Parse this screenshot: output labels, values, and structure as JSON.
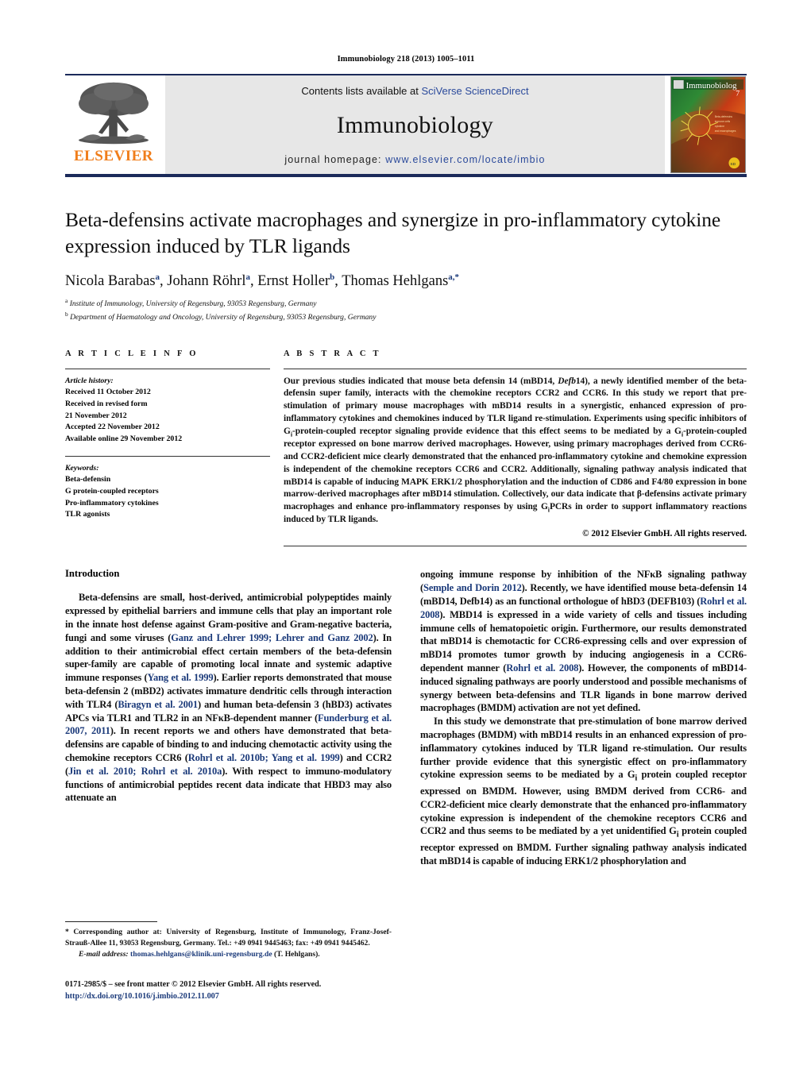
{
  "running_head": "Immunobiology 218 (2013) 1005–1011",
  "masthead": {
    "publisher_name": "ELSEVIER",
    "contents_prefix": "Contents lists available at ",
    "contents_link": "SciVerse ScienceDirect",
    "journal_name": "Immunobiology",
    "homepage_prefix": "journal homepage: ",
    "homepage_url": "www.elsevier.com/locate/imbio",
    "cover_title": "Immunobiology"
  },
  "article": {
    "title": "Beta-defensins activate macrophages and synergize in pro-inflammatory cytokine expression induced by TLR ligands",
    "authors_html": "Nicola Barabas<sup>a</sup>, Johann Röhrl<sup>a</sup>, Ernst Holler<sup>b</sup>, Thomas Hehlgans<sup>a,*</sup>",
    "affiliations": [
      "Institute of Immunology, University of Regensburg, 93053 Regensburg, Germany",
      "Department of Haematology and Oncology, University of Regensburg, 93053 Regensburg, Germany"
    ],
    "affiliation_marks": [
      "a",
      "b"
    ]
  },
  "article_info": {
    "heading": "A R T I C L E   I N F O",
    "history_label": "Article history:",
    "history_lines": [
      "Received 11 October 2012",
      "Received in revised form",
      "21 November 2012",
      "Accepted 22 November 2012",
      "Available online 29 November 2012"
    ],
    "keywords_label": "Keywords:",
    "keywords": [
      "Beta-defensin",
      "G protein-coupled receptors",
      "Pro-inflammatory cytokines",
      "TLR agonists"
    ]
  },
  "abstract": {
    "heading": "A B S T R A C T",
    "text_html": "Our previous studies indicated that mouse beta defensin 14 (mBD14, <i>Defb</i>14), a newly identified member of the beta-defensin super family, interacts with the chemokine receptors CCR2 and CCR6. In this study we report that pre-stimulation of primary mouse macrophages with mBD14 results in a synergistic, enhanced expression of pro-inflammatory cytokines and chemokines induced by TLR ligand re-stimulation. Experiments using specific inhibitors of G<sub>i</sub>-protein-coupled receptor signaling provide evidence that this effect seems to be mediated by a G<sub>i</sub>-protein-coupled receptor expressed on bone marrow derived macrophages. However, using primary macrophages derived from CCR6- and CCR2-deficient mice clearly demonstrated that the enhanced pro-inflammatory cytokine and chemokine expression is independent of the chemokine receptors CCR6 and CCR2. Additionally, signaling pathway analysis indicated that mBD14 is capable of inducing MAPK ERK1/2 phosphorylation and the induction of CD86 and F4/80 expression in bone marrow-derived macrophages after mBD14 stimulation. Collectively, our data indicate that β-defensins activate primary macrophages and enhance pro-inflammatory responses by using G<sub>i</sub>PCRs in order to support inflammatory reactions induced by TLR ligands.",
    "copyright": "© 2012 Elsevier GmbH. All rights reserved."
  },
  "introduction": {
    "heading": "Introduction",
    "left_paragraph_1_html": "Beta-defensins are small, host-derived, antimicrobial polypeptides mainly expressed by epithelial barriers and immune cells that play an important role in the innate host defense against Gram-positive and Gram-negative bacteria, fungi and some viruses (<span class=\"cite\">Ganz and Lehrer 1999; Lehrer and Ganz 2002</span>). In addition to their antimicrobial effect certain members of the beta-defensin super-family are capable of promoting local innate and systemic adaptive immune responses (<span class=\"cite\">Yang et al. 1999</span>). Earlier reports demonstrated that mouse beta-defensin 2 (mBD2) activates immature dendritic cells through interaction with TLR4 (<span class=\"cite\">Biragyn et al. 2001</span>) and human beta-defensin 3 (hBD3) activates APCs via TLR1 and TLR2 in an NFκB-dependent manner (<span class=\"cite\">Funderburg et al. 2007, 2011</span>). In recent reports we and others have demonstrated that beta-defensins are capable of binding to and inducing chemotactic activity using the chemokine receptors CCR6 (<span class=\"cite\">Rohrl et al. 2010b; Yang et al. 1999</span>) and CCR2 (<span class=\"cite\">Jin et al. 2010; Rohrl et al. 2010a</span>). With respect to immuno-modulatory functions of antimicrobial peptides recent data indicate that HBD3 may also attenuate an",
    "right_paragraph_1_html": "ongoing immune response by inhibition of the NFκB signaling pathway (<span class=\"cite\">Semple and Dorin 2012</span>). Recently, we have identified mouse beta-defensin 14 (mBD14, Defb14) as an functional orthologue of hBD3 (DEFB103) (<span class=\"cite\">Rohrl et al. 2008</span>). MBD14 is expressed in a wide variety of cells and tissues including immune cells of hematopoietic origin. Furthermore, our results demonstrated that mBD14 is chemotactic for CCR6-expressing cells and over expression of mBD14 promotes tumor growth by inducing angiogenesis in a CCR6-dependent manner (<span class=\"cite\">Rohrl et al. 2008</span>). However, the components of mBD14-induced signaling pathways are poorly understood and possible mechanisms of synergy between beta-defensins and TLR ligands in bone marrow derived macrophages (BMDM) activation are not yet defined.",
    "right_paragraph_2_html": "In this study we demonstrate that pre-stimulation of bone marrow derived macrophages (BMDM) with mBD14 results in an enhanced expression of pro-inflammatory cytokines induced by TLR ligand re-stimulation. Our results further provide evidence that this synergistic effect on pro-inflammatory cytokine expression seems to be mediated by a G<sub>i</sub> protein coupled receptor expressed on BMDM. However, using BMDM derived from CCR6- and CCR2-deficient mice clearly demonstrate that the enhanced pro-inflammatory cytokine expression is independent of the chemokine receptors CCR6 and CCR2 and thus seems to be mediated by a yet unidentified G<sub>i</sub> protein coupled receptor expressed on BMDM. Further signaling pathway analysis indicated that mBD14 is capable of inducing ERK1/2 phosphorylation and"
  },
  "footnotes": {
    "corresponding_html": "* Corresponding author at: University of Regensburg, Institute of Immunology, Franz-Josef-Strauß-Allee 11, 93053 Regensburg, Germany. Tel.: +49 0941 9445463; fax: +49 0941 9445462.",
    "email_label": "E-mail address:",
    "email": "thomas.hehlgans@klinik.uni-regensburg.de",
    "email_suffix": "(T. Hehlgans)."
  },
  "imprint": {
    "issn_line": "0171-2985/$ – see front matter © 2012 Elsevier GmbH. All rights reserved.",
    "doi": "http://dx.doi.org/10.1016/j.imbio.2012.11.007"
  },
  "colors": {
    "rule_navy": "#1b2a5a",
    "link_blue": "#2b4a9b",
    "cite_blue": "#1b3a7a",
    "elsevier_orange": "#f07d1a",
    "band_gray": "#e7e7e7"
  }
}
